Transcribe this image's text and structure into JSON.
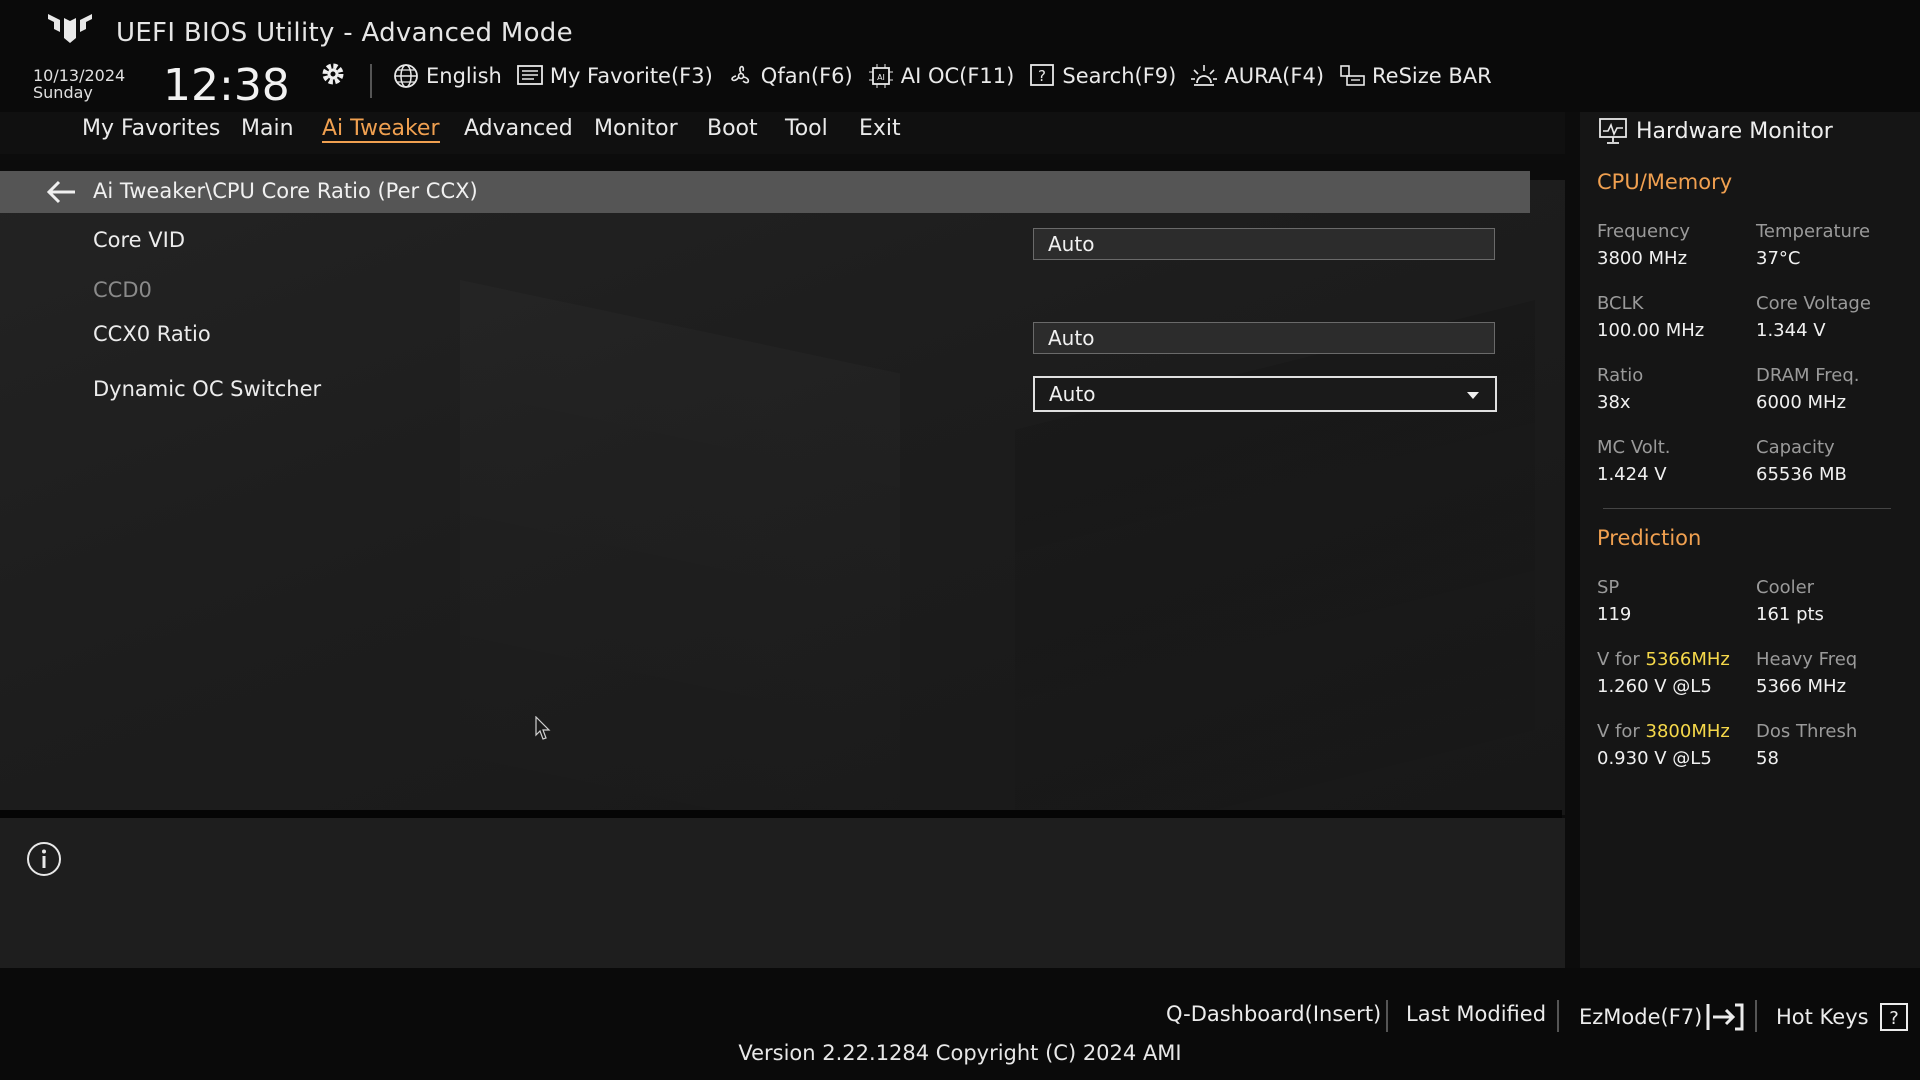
{
  "header": {
    "app_title": "UEFI BIOS Utility - Advanced Mode",
    "date": "10/13/2024",
    "day": "Sunday",
    "time": "12:38",
    "toolbar": [
      {
        "label": "English",
        "icon": "globe-icon"
      },
      {
        "label": "My Favorite(F3)",
        "icon": "favorite-list-icon"
      },
      {
        "label": "Qfan(F6)",
        "icon": "fan-icon"
      },
      {
        "label": "AI OC(F11)",
        "icon": "ai-chip-icon"
      },
      {
        "label": "Search(F9)",
        "icon": "search-help-icon"
      },
      {
        "label": "AURA(F4)",
        "icon": "aura-light-icon"
      },
      {
        "label": "ReSize BAR",
        "icon": "resize-bar-icon"
      }
    ]
  },
  "nav": {
    "tabs": [
      "My Favorites",
      "Main",
      "Ai Tweaker",
      "Advanced",
      "Monitor",
      "Boot",
      "Tool",
      "Exit"
    ],
    "active": "Ai Tweaker"
  },
  "breadcrumb": "Ai Tweaker\\CPU Core Ratio (Per CCX)",
  "settings": {
    "core_vid": {
      "label": "Core VID",
      "value": "Auto"
    },
    "ccd0_heading": "CCD0",
    "ccx0_ratio": {
      "label": "CCX0 Ratio",
      "value": "Auto"
    },
    "dynamic_oc": {
      "label": "Dynamic OC Switcher",
      "value": "Auto"
    }
  },
  "hardware_monitor": {
    "title": "Hardware Monitor",
    "cpu_memory": {
      "heading": "CPU/Memory",
      "frequency_label": "Frequency",
      "frequency": "3800 MHz",
      "temperature_label": "Temperature",
      "temperature": "37°C",
      "bclk_label": "BCLK",
      "bclk": "100.00 MHz",
      "core_voltage_label": "Core Voltage",
      "core_voltage": "1.344 V",
      "ratio_label": "Ratio",
      "ratio": "38x",
      "dram_freq_label": "DRAM Freq.",
      "dram_freq": "6000 MHz",
      "mc_volt_label": "MC Volt.",
      "mc_volt": "1.424 V",
      "capacity_label": "Capacity",
      "capacity": "65536 MB"
    },
    "prediction": {
      "heading": "Prediction",
      "sp_label": "SP",
      "sp": "119",
      "cooler_label": "Cooler",
      "cooler": "161 pts",
      "v_for_prefix": "V for ",
      "v1_freq": "5366MHz",
      "v1_value": "1.260 V @L5",
      "heavy_freq_label": "Heavy Freq",
      "heavy_freq": "5366 MHz",
      "v2_freq": "3800MHz",
      "v2_value": "0.930 V @L5",
      "dos_thresh_label": "Dos Thresh",
      "dos_thresh": "58"
    }
  },
  "footer": {
    "q_dashboard": "Q-Dashboard(Insert)",
    "last_modified": "Last Modified",
    "ezmode": "EzMode(F7)",
    "hot_keys": "Hot Keys",
    "version": "Version 2.22.1284 Copyright (C) 2024 AMI"
  },
  "colors": {
    "accent": "#f0a050",
    "highlight": "#f5d84a",
    "background": "#0c0c0c"
  }
}
